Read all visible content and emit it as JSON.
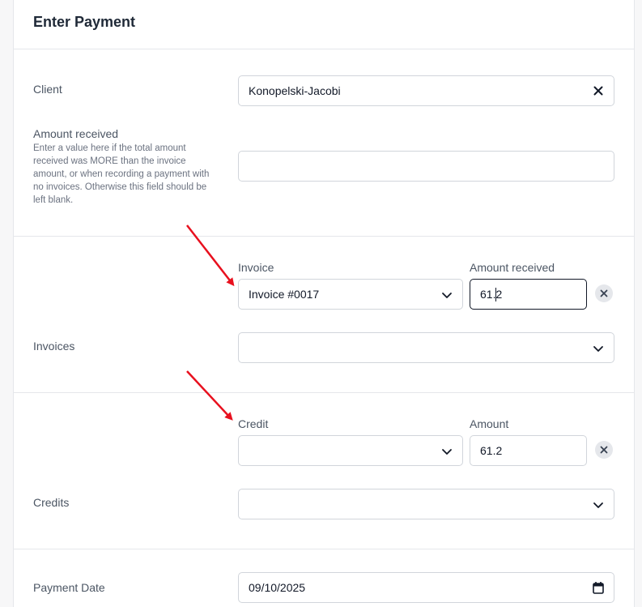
{
  "page": {
    "title": "Enter Payment"
  },
  "client": {
    "label": "Client",
    "value": "Konopelski-Jacobi"
  },
  "amount_received": {
    "label": "Amount received",
    "help": "Enter a value here if the total amount received was MORE than the invoice amount, or when recording a payment with no invoices. Otherwise this field should be left blank.",
    "value": ""
  },
  "invoices": {
    "label": "Invoices",
    "invoice_col_label": "Invoice",
    "amount_col_label": "Amount received",
    "rows": [
      {
        "invoice": "Invoice #0017",
        "amount": "61.2"
      }
    ],
    "empty_select_value": ""
  },
  "credits": {
    "label": "Credits",
    "credit_col_label": "Credit",
    "amount_col_label": "Amount",
    "rows": [
      {
        "credit": "",
        "amount": "61.2"
      }
    ],
    "empty_select_value": ""
  },
  "payment_date": {
    "label": "Payment Date",
    "value": "09/10/2025"
  },
  "colors": {
    "arrow": "#e8101e",
    "focus_border": "#111827",
    "border": "#d1d5db"
  }
}
